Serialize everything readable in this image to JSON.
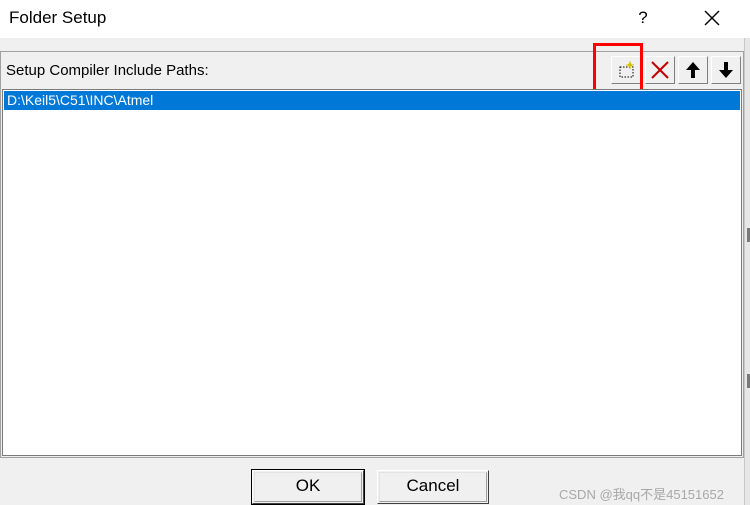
{
  "window": {
    "title": "Folder Setup",
    "help_label": "?"
  },
  "section": {
    "label": "Setup Compiler Include Paths:"
  },
  "toolbar": {
    "icons": [
      "new-folder-icon",
      "delete-icon",
      "move-up-icon",
      "move-down-icon"
    ]
  },
  "paths": {
    "items": [
      "D:\\Keil5\\C51\\INC\\Atmel"
    ],
    "selected_index": 0
  },
  "buttons": {
    "ok_label": "OK",
    "cancel_label": "Cancel"
  },
  "watermark": "CSDN @我qq不是45151652",
  "colors": {
    "selection": "#0078d7",
    "highlight_box": "#ff0000",
    "delete_icon": "#c00000"
  }
}
